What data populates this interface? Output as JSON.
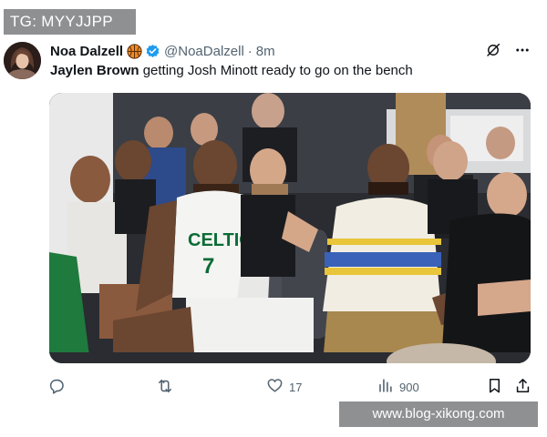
{
  "overlay": {
    "top_label": "TG: MYYJJPP",
    "bottom_label": "www.blog-xikong.com"
  },
  "tweet": {
    "author": {
      "display_name": "Noa Dalzell",
      "badge_emoji": "basketball",
      "handle": "@NoaDalzell",
      "separator": "·",
      "time": "8m"
    },
    "text": {
      "bold": "Jaylen Brown",
      "rest": " getting Josh Minott ready to go on the bench"
    },
    "media": {
      "jerseys": [
        {
          "team_text": "CELTICS",
          "number": "7"
        },
        {
          "team_text": "",
          "number": ""
        }
      ]
    },
    "actions": {
      "reply_count": "",
      "repost_count": "",
      "like_count": "17",
      "views_count": "900"
    },
    "icons": {
      "grok": "grok-slash-icon",
      "more": "more-horizontal-icon",
      "reply": "reply-icon",
      "repost": "repost-icon",
      "like": "heart-icon",
      "views": "views-bars-icon",
      "bookmark": "bookmark-icon",
      "share": "share-icon",
      "verified": "verified-badge-icon"
    },
    "colors": {
      "verified": "#1d9bf0",
      "text": "#0f1419",
      "muted": "#536471",
      "celtics_green": "#007a33"
    }
  }
}
